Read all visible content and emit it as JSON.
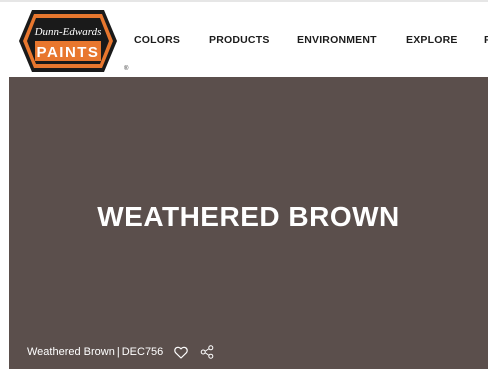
{
  "brand": {
    "script_name": "Dunn-Edwards",
    "wordmark": "PAINTS",
    "registered": "®",
    "colors": {
      "orange": "#e8772e",
      "black": "#1a1a1a"
    }
  },
  "nav": {
    "items": [
      {
        "label": "COLORS"
      },
      {
        "label": "PRODUCTS"
      },
      {
        "label": "ENVIRONMENT"
      },
      {
        "label": "EXPLORE"
      },
      {
        "label": "F"
      }
    ]
  },
  "hero": {
    "title": "WEATHERED BROWN",
    "swatch_color": "#5b4f4c",
    "color_name": "Weathered Brown",
    "separator": "|",
    "color_code": "DEC756",
    "icons": [
      "heart-icon",
      "share-icon"
    ]
  }
}
